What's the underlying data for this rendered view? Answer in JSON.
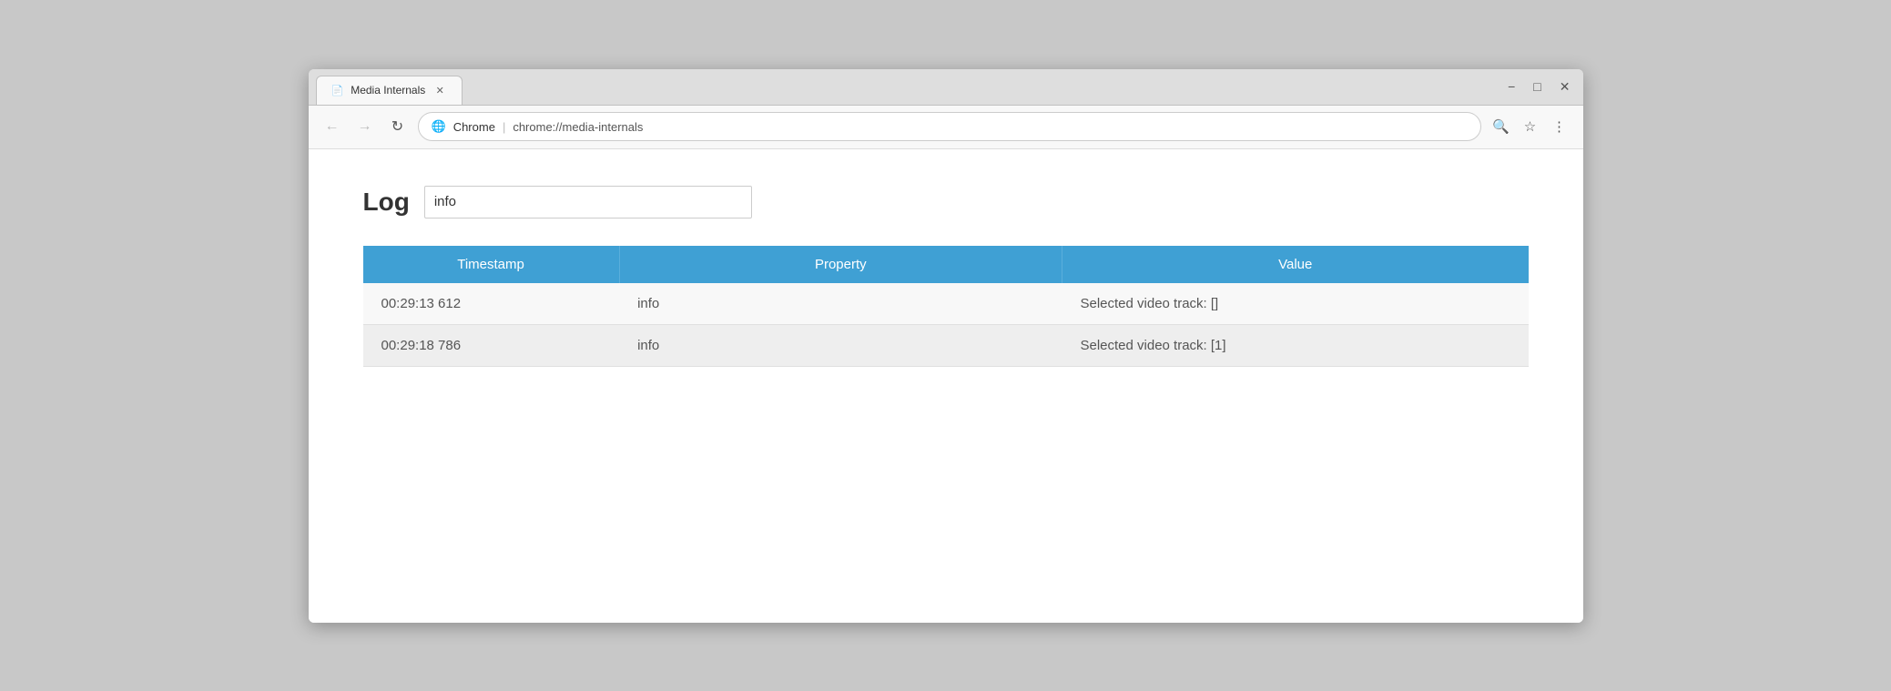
{
  "browser": {
    "tab_title": "Media Internals",
    "tab_icon": "📄",
    "tab_close": "✕",
    "url_security": "🌐",
    "url_origin": "Chrome",
    "url_separator": "|",
    "url_path": "chrome://media-internals",
    "nav_back": "←",
    "nav_forward": "→",
    "nav_reload": "↻",
    "search_icon": "🔍",
    "star_icon": "☆",
    "menu_icon": "⋮",
    "win_minimize": "−",
    "win_maximize": "□",
    "win_close": "✕"
  },
  "page": {
    "log_label": "Log",
    "log_input_value": "info",
    "log_input_placeholder": ""
  },
  "table": {
    "headers": {
      "timestamp": "Timestamp",
      "property": "Property",
      "value": "Value"
    },
    "rows": [
      {
        "timestamp": "00:29:13 612",
        "property": "info",
        "value": "Selected video track: []"
      },
      {
        "timestamp": "00:29:18 786",
        "property": "info",
        "value": "Selected video track: [1]"
      }
    ]
  }
}
